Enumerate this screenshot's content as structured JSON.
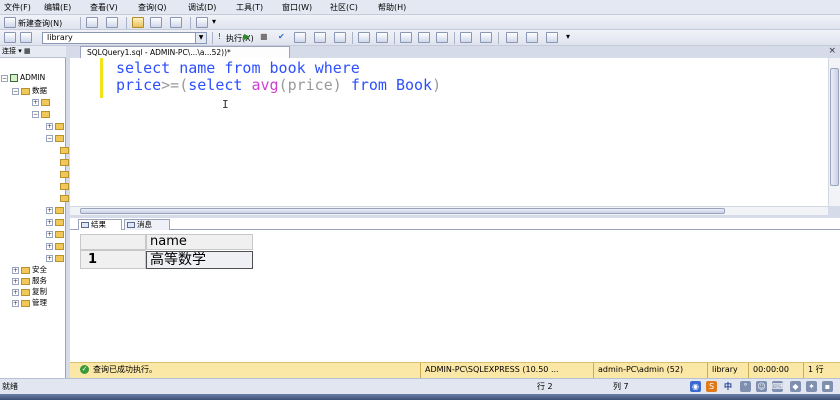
{
  "menu": {
    "items": [
      "文件(F)",
      "编辑(E)",
      "查看(V)",
      "查询(Q)",
      "调试(D)",
      "工具(T)",
      "窗口(W)",
      "社区(C)",
      "帮助(H)"
    ]
  },
  "toolbar": {
    "new_query_label": "新建查询(N)",
    "execute_label": "执行(X)",
    "database_selected": "library"
  },
  "object_explorer": {
    "header_label": "连接",
    "server_label": "ADMIN",
    "databases_label": "数据",
    "nodes": [
      "安全",
      "服务",
      "复制",
      "管理"
    ]
  },
  "document": {
    "tab_title": "SQLQuery1.sql - ADMIN-PC\\...\\a...52))*"
  },
  "editor": {
    "line1": {
      "select": "select",
      "name": " name ",
      "from": "from",
      "book": " book ",
      "where": "where"
    },
    "line2": {
      "price": "price",
      "op": ">=",
      "open": "(",
      "select": "select",
      "avg": "avg",
      "arg": "(price)",
      "from": "from",
      "Book": " Book",
      "close": ")"
    }
  },
  "results": {
    "tabs": [
      "结果",
      "消息"
    ],
    "columns": [
      "name"
    ],
    "rows": [
      {
        "row_number": "1",
        "name": "高等数学"
      }
    ]
  },
  "query_status": {
    "message": "查询已成功执行。",
    "server": "ADMIN-PC\\SQLEXPRESS (10.50 ...",
    "user": "admin-PC\\admin (52)",
    "database": "library",
    "elapsed": "00:00:00",
    "rows": "1 行"
  },
  "status_bar": {
    "ready": "就绪",
    "line": "行 2",
    "column": "列 7",
    "ime_label": "中"
  },
  "colors": {
    "keyword": "#2d4fff",
    "function": "#d040d0",
    "operator": "#9a9a9a",
    "status_bg": "#fbe7a6"
  }
}
